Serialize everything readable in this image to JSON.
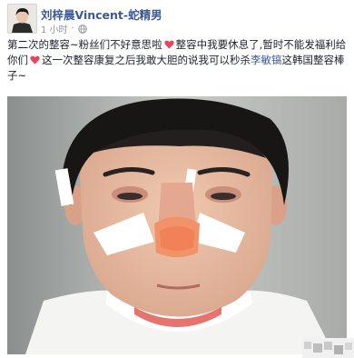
{
  "author": {
    "name": "刘梓晨Vincent-蛇精男"
  },
  "meta": {
    "time": "1 小时",
    "audience_icon": "globe-icon"
  },
  "post": {
    "text_part1": "第二次的整容~粉丝们不好意思啦",
    "text_part2": "整容中我要休息了,暂时不能发福利给你们",
    "text_part3": "这一次整容康复之后我敢大胆的说我可以秒杀",
    "mention": "李敏镐",
    "text_part4": "这韩国整容棒子~",
    "emoji": "heart-icon",
    "emoji_color": "#e8455a"
  },
  "photo": {
    "subject": "post-photo"
  },
  "colors": {
    "link": "#3b5998",
    "text": "#1d2129",
    "meta": "#90949c"
  }
}
